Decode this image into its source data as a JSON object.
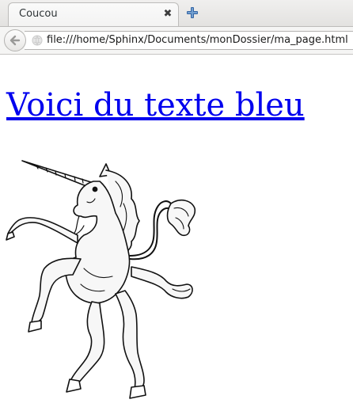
{
  "tab": {
    "title": "Coucou",
    "close_glyph": "✖",
    "icons": {
      "close": "close-icon",
      "new_tab": "plus-icon"
    }
  },
  "navbar": {
    "url": "file:///home/Sphinx/Documents/monDossier/ma_page.html",
    "icons": {
      "back": "back-arrow-icon",
      "site": "site-identity-icon"
    }
  },
  "page": {
    "link_text": "Voici du texte bleu",
    "link_color": "#0000ee",
    "image": "unicorn-heraldic-illustration"
  }
}
